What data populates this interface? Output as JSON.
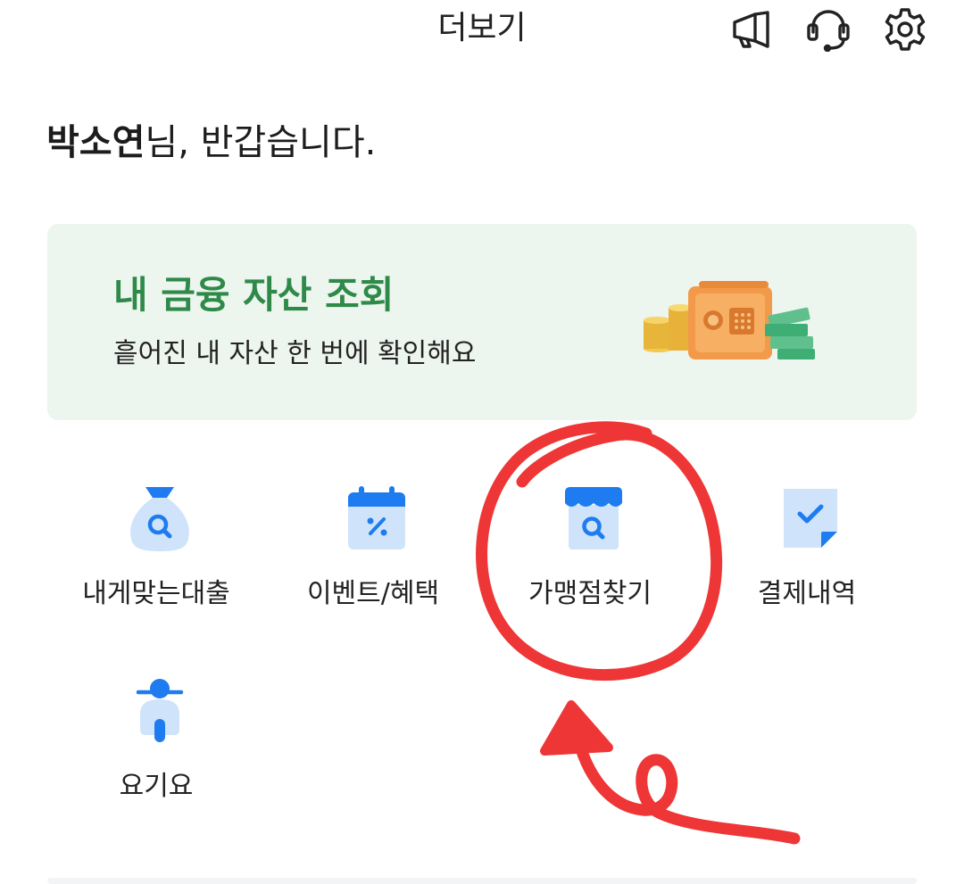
{
  "header": {
    "title": "더보기"
  },
  "greeting": {
    "name": "박소연",
    "suffix": "님, 반갑습니다."
  },
  "banner": {
    "title": "내 금융 자산 조회",
    "subtitle": "흩어진 내 자산 한 번에 확인해요"
  },
  "menu": [
    {
      "label": "내게맞는대출",
      "icon": "money-bag-search-icon"
    },
    {
      "label": "이벤트/혜택",
      "icon": "calendar-percent-icon"
    },
    {
      "label": "가맹점찾기",
      "icon": "store-search-icon"
    },
    {
      "label": "결제내역",
      "icon": "receipt-check-icon"
    },
    {
      "label": "요기요",
      "icon": "scooter-icon"
    }
  ],
  "colors": {
    "accent_blue": "#1e7cf0",
    "light_blue": "#cfe3fb",
    "banner_green": "#2f8a4a",
    "annotation_red": "#ee3636"
  }
}
